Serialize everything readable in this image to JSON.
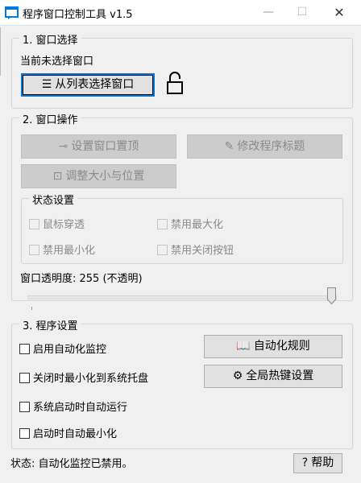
{
  "window": {
    "title": "程序窗口控制工具 v1.5",
    "min_glyph": "—",
    "max_glyph": "☐",
    "close_glyph": "✕"
  },
  "section1": {
    "legend": "1. 窗口选择",
    "status": "当前未选择窗口",
    "select_button": {
      "icon": "list-icon",
      "glyph": "☰",
      "label": "从列表选择窗口"
    },
    "lock_icon": "unlocked-padlock-icon"
  },
  "section2": {
    "legend": "2. 窗口操作",
    "topmost_button": {
      "icon": "pin-icon",
      "glyph": "⊸",
      "label": "设置窗口置顶"
    },
    "rename_button": {
      "icon": "pencil-icon",
      "glyph": "✎",
      "label": "修改程序标题"
    },
    "resize_button": {
      "icon": "resize-icon",
      "glyph": "⊡",
      "label": "调整大小与位置"
    },
    "state_group": {
      "legend": "状态设置",
      "mouse_through": "鼠标穿透",
      "disable_maximize": "禁用最大化",
      "disable_minimize": "禁用最小化",
      "disable_close": "禁用关闭按钮"
    },
    "opacity_label": "窗口透明度: 255 (不透明)",
    "opacity_value": 255,
    "opacity_max": 255
  },
  "section3": {
    "legend": "3. 程序设置",
    "enable_monitor": "启用自动化监控",
    "minimize_to_tray": "关闭时最小化到系统托盘",
    "autostart": "系统启动时自动运行",
    "start_minimized": "启动时自动最小化",
    "rules_button": {
      "icon": "book-icon",
      "glyph": "📖",
      "label": "自动化规则"
    },
    "hotkey_button": {
      "icon": "gear-icon",
      "glyph": "⚙",
      "label": "全局热键设置"
    }
  },
  "statusbar": {
    "text": "状态: 自动化监控已禁用。",
    "help_button": {
      "glyph": "?",
      "label": "帮助"
    }
  },
  "colors": {
    "accent": "#0078d7",
    "background": "#f0f0f0",
    "disabled_text": "#8a8a8a"
  }
}
